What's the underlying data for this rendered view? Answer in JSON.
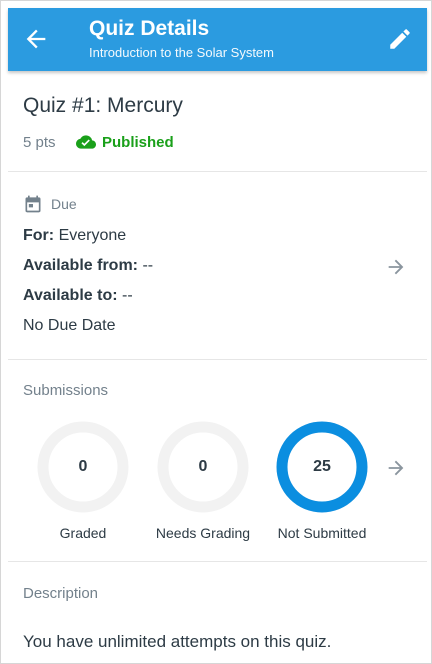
{
  "app_bar": {
    "title": "Quiz Details",
    "subtitle": "Introduction to the Solar System",
    "back_icon": "arrow-left-icon",
    "edit_icon": "pencil-icon",
    "color": "#2b9be0"
  },
  "quiz": {
    "title": "Quiz #1: Mercury",
    "points": "5 pts",
    "status": "Published",
    "status_color": "#1aa01a"
  },
  "due": {
    "heading": "Due",
    "for_label": "For:",
    "for_value": "Everyone",
    "available_from_label": "Available from:",
    "available_from_value": "--",
    "available_to_label": "Available to:",
    "available_to_value": "--",
    "no_due_date": "No Due Date"
  },
  "submissions": {
    "heading": "Submissions",
    "items": [
      {
        "label": "Graded",
        "count": "0",
        "fraction": 0
      },
      {
        "label": "Needs Grading",
        "count": "0",
        "fraction": 0
      },
      {
        "label": "Not Submitted",
        "count": "25",
        "fraction": 1
      }
    ],
    "ring_color": "#0b8ee0",
    "track_color": "#f2f2f2"
  },
  "description": {
    "heading": "Description",
    "text": "You have unlimited attempts on this quiz."
  }
}
